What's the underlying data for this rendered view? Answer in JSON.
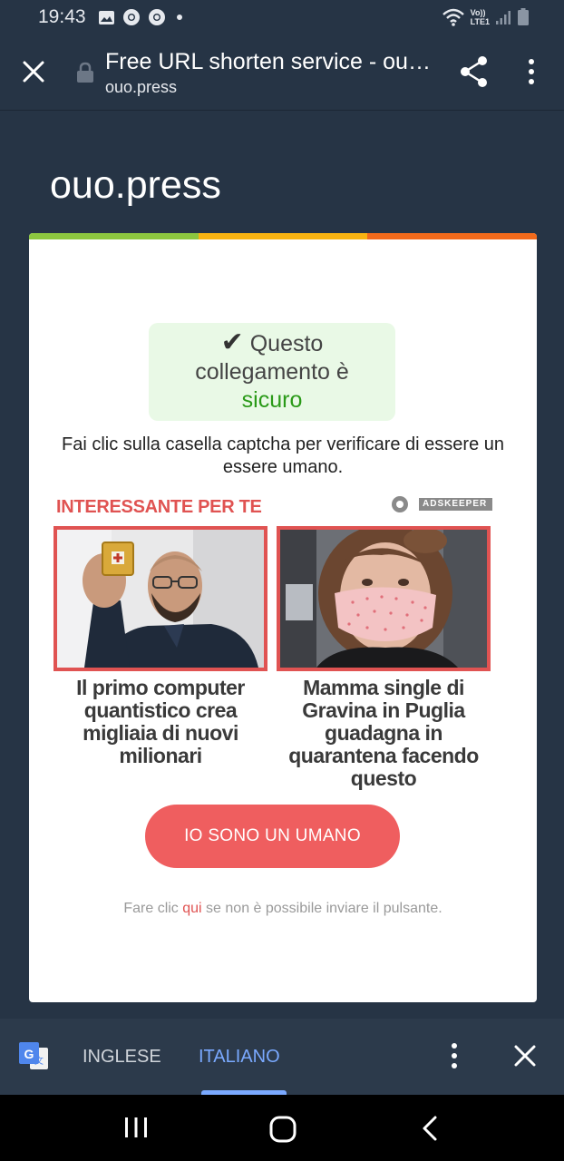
{
  "status_bar": {
    "time": "19:43",
    "network_label_top": "Vo))",
    "network_label_bottom": "LTE1",
    "icons": [
      "image-icon",
      "chrome-icon",
      "chrome-icon",
      "dot-icon",
      "wifi-icon",
      "signal-icon",
      "battery-icon"
    ]
  },
  "browser": {
    "title": "Free URL shorten service - ouo.press",
    "url": "ouo.press"
  },
  "page": {
    "site_title": "ouo.press",
    "safe_line1": "Questo",
    "safe_line2": "collegamento è",
    "safe_line3": "sicuro",
    "captcha_text": "Fai clic sulla casella captcha per verificare di essere un essere umano.",
    "ads_heading": "INTERESSANTE PER TE",
    "adskeeper_label": "ADSKEEPER",
    "ads": [
      {
        "title": "Il primo computer quantistico crea migliaia di nuovi milionari"
      },
      {
        "title": "Mamma single di Gravina in Puglia guadagna in quarantena facendo questo"
      }
    ],
    "human_button": "IO SONO UN UMANO",
    "footer_before": "Fare clic ",
    "footer_link": "qui",
    "footer_after": " se non è possibile inviare il pulsante.",
    "topbar_colors": [
      "#8cc63f",
      "#f9b311",
      "#f26a1b"
    ],
    "accent_color": "#ef5e5f"
  },
  "translate_bar": {
    "lang_source": "INGLESE",
    "lang_target": "ITALIANO",
    "active_color": "#7aa9ff"
  }
}
